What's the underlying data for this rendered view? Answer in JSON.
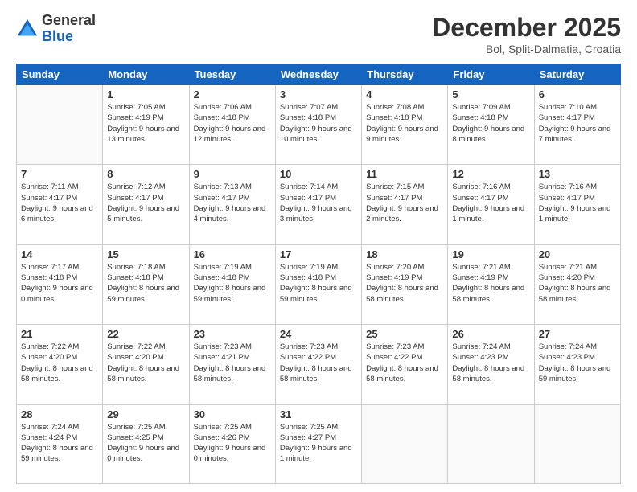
{
  "logo": {
    "general": "General",
    "blue": "Blue"
  },
  "title": "December 2025",
  "subtitle": "Bol, Split-Dalmatia, Croatia",
  "days_header": [
    "Sunday",
    "Monday",
    "Tuesday",
    "Wednesday",
    "Thursday",
    "Friday",
    "Saturday"
  ],
  "weeks": [
    [
      {
        "day": "",
        "info": ""
      },
      {
        "day": "1",
        "info": "Sunrise: 7:05 AM\nSunset: 4:19 PM\nDaylight: 9 hours\nand 13 minutes."
      },
      {
        "day": "2",
        "info": "Sunrise: 7:06 AM\nSunset: 4:18 PM\nDaylight: 9 hours\nand 12 minutes."
      },
      {
        "day": "3",
        "info": "Sunrise: 7:07 AM\nSunset: 4:18 PM\nDaylight: 9 hours\nand 10 minutes."
      },
      {
        "day": "4",
        "info": "Sunrise: 7:08 AM\nSunset: 4:18 PM\nDaylight: 9 hours\nand 9 minutes."
      },
      {
        "day": "5",
        "info": "Sunrise: 7:09 AM\nSunset: 4:18 PM\nDaylight: 9 hours\nand 8 minutes."
      },
      {
        "day": "6",
        "info": "Sunrise: 7:10 AM\nSunset: 4:17 PM\nDaylight: 9 hours\nand 7 minutes."
      }
    ],
    [
      {
        "day": "7",
        "info": "Sunrise: 7:11 AM\nSunset: 4:17 PM\nDaylight: 9 hours\nand 6 minutes."
      },
      {
        "day": "8",
        "info": "Sunrise: 7:12 AM\nSunset: 4:17 PM\nDaylight: 9 hours\nand 5 minutes."
      },
      {
        "day": "9",
        "info": "Sunrise: 7:13 AM\nSunset: 4:17 PM\nDaylight: 9 hours\nand 4 minutes."
      },
      {
        "day": "10",
        "info": "Sunrise: 7:14 AM\nSunset: 4:17 PM\nDaylight: 9 hours\nand 3 minutes."
      },
      {
        "day": "11",
        "info": "Sunrise: 7:15 AM\nSunset: 4:17 PM\nDaylight: 9 hours\nand 2 minutes."
      },
      {
        "day": "12",
        "info": "Sunrise: 7:16 AM\nSunset: 4:17 PM\nDaylight: 9 hours\nand 1 minute."
      },
      {
        "day": "13",
        "info": "Sunrise: 7:16 AM\nSunset: 4:17 PM\nDaylight: 9 hours\nand 1 minute."
      }
    ],
    [
      {
        "day": "14",
        "info": "Sunrise: 7:17 AM\nSunset: 4:18 PM\nDaylight: 9 hours\nand 0 minutes."
      },
      {
        "day": "15",
        "info": "Sunrise: 7:18 AM\nSunset: 4:18 PM\nDaylight: 8 hours\nand 59 minutes."
      },
      {
        "day": "16",
        "info": "Sunrise: 7:19 AM\nSunset: 4:18 PM\nDaylight: 8 hours\nand 59 minutes."
      },
      {
        "day": "17",
        "info": "Sunrise: 7:19 AM\nSunset: 4:18 PM\nDaylight: 8 hours\nand 59 minutes."
      },
      {
        "day": "18",
        "info": "Sunrise: 7:20 AM\nSunset: 4:19 PM\nDaylight: 8 hours\nand 58 minutes."
      },
      {
        "day": "19",
        "info": "Sunrise: 7:21 AM\nSunset: 4:19 PM\nDaylight: 8 hours\nand 58 minutes."
      },
      {
        "day": "20",
        "info": "Sunrise: 7:21 AM\nSunset: 4:20 PM\nDaylight: 8 hours\nand 58 minutes."
      }
    ],
    [
      {
        "day": "21",
        "info": "Sunrise: 7:22 AM\nSunset: 4:20 PM\nDaylight: 8 hours\nand 58 minutes."
      },
      {
        "day": "22",
        "info": "Sunrise: 7:22 AM\nSunset: 4:20 PM\nDaylight: 8 hours\nand 58 minutes."
      },
      {
        "day": "23",
        "info": "Sunrise: 7:23 AM\nSunset: 4:21 PM\nDaylight: 8 hours\nand 58 minutes."
      },
      {
        "day": "24",
        "info": "Sunrise: 7:23 AM\nSunset: 4:22 PM\nDaylight: 8 hours\nand 58 minutes."
      },
      {
        "day": "25",
        "info": "Sunrise: 7:23 AM\nSunset: 4:22 PM\nDaylight: 8 hours\nand 58 minutes."
      },
      {
        "day": "26",
        "info": "Sunrise: 7:24 AM\nSunset: 4:23 PM\nDaylight: 8 hours\nand 58 minutes."
      },
      {
        "day": "27",
        "info": "Sunrise: 7:24 AM\nSunset: 4:23 PM\nDaylight: 8 hours\nand 59 minutes."
      }
    ],
    [
      {
        "day": "28",
        "info": "Sunrise: 7:24 AM\nSunset: 4:24 PM\nDaylight: 8 hours\nand 59 minutes."
      },
      {
        "day": "29",
        "info": "Sunrise: 7:25 AM\nSunset: 4:25 PM\nDaylight: 9 hours\nand 0 minutes."
      },
      {
        "day": "30",
        "info": "Sunrise: 7:25 AM\nSunset: 4:26 PM\nDaylight: 9 hours\nand 0 minutes."
      },
      {
        "day": "31",
        "info": "Sunrise: 7:25 AM\nSunset: 4:27 PM\nDaylight: 9 hours\nand 1 minute."
      },
      {
        "day": "",
        "info": ""
      },
      {
        "day": "",
        "info": ""
      },
      {
        "day": "",
        "info": ""
      }
    ]
  ]
}
